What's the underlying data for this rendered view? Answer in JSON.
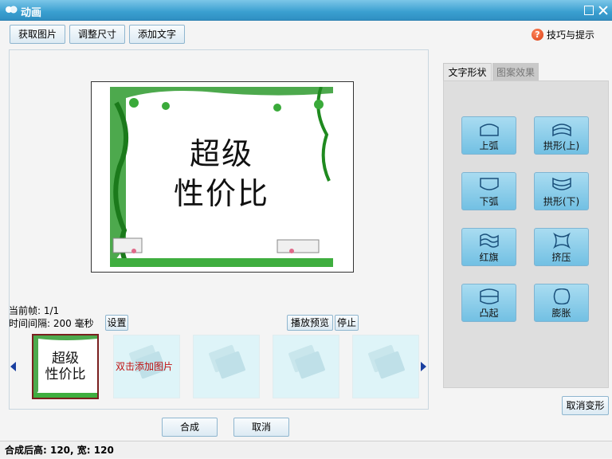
{
  "window": {
    "title": "动画"
  },
  "toolbar": {
    "get_image": "获取图片",
    "resize": "调整尺寸",
    "add_text": "添加文字",
    "tips": "技巧与提示"
  },
  "preview": {
    "line1": "超级",
    "line2": "性价比"
  },
  "info": {
    "current_frame": "当前帧: 1/1",
    "interval": "时间间隔: 200 毫秒",
    "settings_button": "设置",
    "play_button": "播放预览",
    "stop_button": "停止"
  },
  "strip": {
    "thumb_line1": "超级",
    "thumb_line2": "性价比",
    "add_hint": "双击添加图片"
  },
  "actions": {
    "compose": "合成",
    "cancel": "取消"
  },
  "right": {
    "tabs": [
      "文字形状",
      "图案效果"
    ],
    "shapes": [
      "上弧",
      "拱形(上)",
      "下弧",
      "拱形(下)",
      "红旗",
      "挤压",
      "凸起",
      "膨胀"
    ],
    "cancel_transform": "取消变形"
  },
  "status": {
    "text": "合成后高: 120, 宽: 120"
  },
  "colors": {
    "titlebar": "#3a9fd0",
    "button_face": "#dceaf3",
    "shape_button": "#8dcfec",
    "add_hint": "#c01010"
  }
}
